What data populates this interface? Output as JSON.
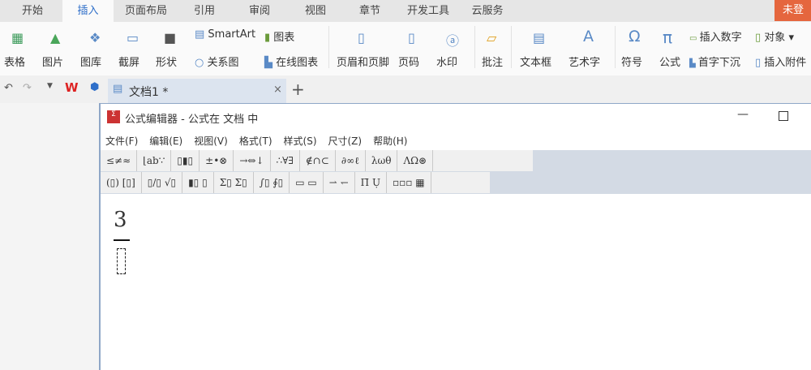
{
  "tabs": [
    "开始",
    "插入",
    "页面布局",
    "引用",
    "审阅",
    "视图",
    "章节",
    "开发工具",
    "云服务"
  ],
  "login": "未登",
  "ribbon": {
    "table": "表格",
    "picture": "图片",
    "gallery": "图库",
    "screenshot": "截屏",
    "shape": "形状",
    "smartart": "SmartArt",
    "chart": "图表",
    "relation": "关系图",
    "online_chart": "在线图表",
    "header_footer": "页眉和页脚",
    "page_number": "页码",
    "watermark": "水印",
    "comment": "批注",
    "textbox": "文本框",
    "wordart": "艺术字",
    "symbol": "符号",
    "formula": "公式",
    "insert_number": "插入数字",
    "object": "对象",
    "dropcap": "首字下沉",
    "attachment": "插入附件"
  },
  "doc_tab": "文档1 *",
  "editor": {
    "title": "公式编辑器 - 公式在 文档 中",
    "menu": [
      "文件(F)",
      "编辑(E)",
      "视图(V)",
      "格式(T)",
      "样式(S)",
      "尺寸(Z)",
      "帮助(H)"
    ],
    "row1": [
      "≤≠≈",
      "⌊ab∵",
      "▯▮▯",
      "±•⊗",
      "→⇔↓",
      "∴∀∃",
      "∉∩⊂",
      "∂∞ℓ",
      "λωθ",
      "ΛΩ⊛"
    ],
    "row2": [
      "(▯) [▯]",
      "▯/▯ √▯",
      "▮▯ ▯",
      "Σ▯ Σ▯",
      "∫▯ ∮▯",
      "▭ ▭",
      "⇀ ↽",
      "Π̄ Ụ",
      "▫▫▫ ▦"
    ],
    "numerator": "3"
  }
}
